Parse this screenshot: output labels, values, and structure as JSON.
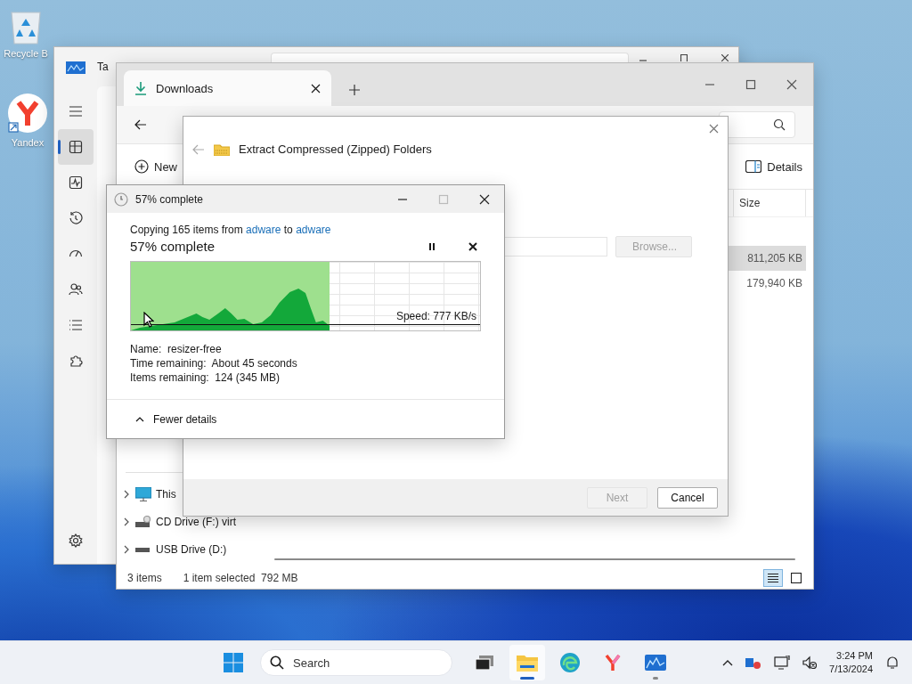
{
  "desktop": {
    "icons": [
      {
        "kind": "recycle-bin",
        "label": "Recycle B"
      },
      {
        "kind": "yandex",
        "label": "Yandex"
      }
    ]
  },
  "task_manager": {
    "title": "Ta",
    "nav": [
      {
        "kind": "menu",
        "selected": false
      },
      {
        "kind": "processes",
        "selected": true
      },
      {
        "kind": "performance",
        "selected": false
      },
      {
        "kind": "history",
        "selected": false
      },
      {
        "kind": "startup",
        "selected": false
      },
      {
        "kind": "users",
        "selected": false
      },
      {
        "kind": "details",
        "selected": false
      },
      {
        "kind": "services",
        "selected": false
      }
    ]
  },
  "explorer": {
    "tabs": [
      {
        "label": "Downloads",
        "selected": true
      }
    ],
    "new_label": "New",
    "details_label": "Details",
    "size_column": "Size",
    "rows": [
      {
        "size": "811,205 KB",
        "selected": true
      },
      {
        "size": "179,940 KB",
        "selected": false
      }
    ],
    "nav_items": [
      {
        "kind": "pc",
        "label": "This",
        "expanded": false
      },
      {
        "kind": "cd",
        "label": "CD Drive (F:) virt",
        "expanded": false
      },
      {
        "kind": "usb",
        "label": "USB Drive (D:)",
        "expanded": false
      }
    ],
    "status": {
      "count": "3 items",
      "selection": "1 item selected  792 MB"
    },
    "view_modes": [
      {
        "kind": "details",
        "selected": true
      },
      {
        "kind": "tiles",
        "selected": false
      }
    ]
  },
  "extract_wizard": {
    "title": "Extract Compressed (Zipped) Folders",
    "browse": {
      "label": "Browse...",
      "disabled": true
    },
    "buttons": [
      {
        "label": "Next",
        "disabled": true
      },
      {
        "label": "Cancel",
        "disabled": false
      }
    ]
  },
  "copy_dialog": {
    "title": "57% complete",
    "prefix": "Copying 165 items from",
    "source": "adware",
    "joiner": "to",
    "destination": "adware",
    "heading": "57% complete",
    "level": 0.57,
    "speed": "Speed: 777 KB/s",
    "details": [
      "Name:  resizer-free",
      "Time remaining:  About 45 seconds",
      "Items remaining:  124 (345 MB)"
    ],
    "toggle": "Fewer details"
  },
  "taskbar": {
    "search_placeholder": "Search",
    "apps": [
      {
        "kind": "task-view",
        "running": false,
        "selected": false
      },
      {
        "kind": "explorer",
        "running": true,
        "selected": true
      },
      {
        "kind": "edge",
        "running": false,
        "selected": false
      },
      {
        "kind": "yandex",
        "running": false,
        "selected": false
      },
      {
        "kind": "task-manager",
        "running": true,
        "selected": false
      }
    ],
    "time": "3:24 PM",
    "date": "7/13/2024"
  }
}
